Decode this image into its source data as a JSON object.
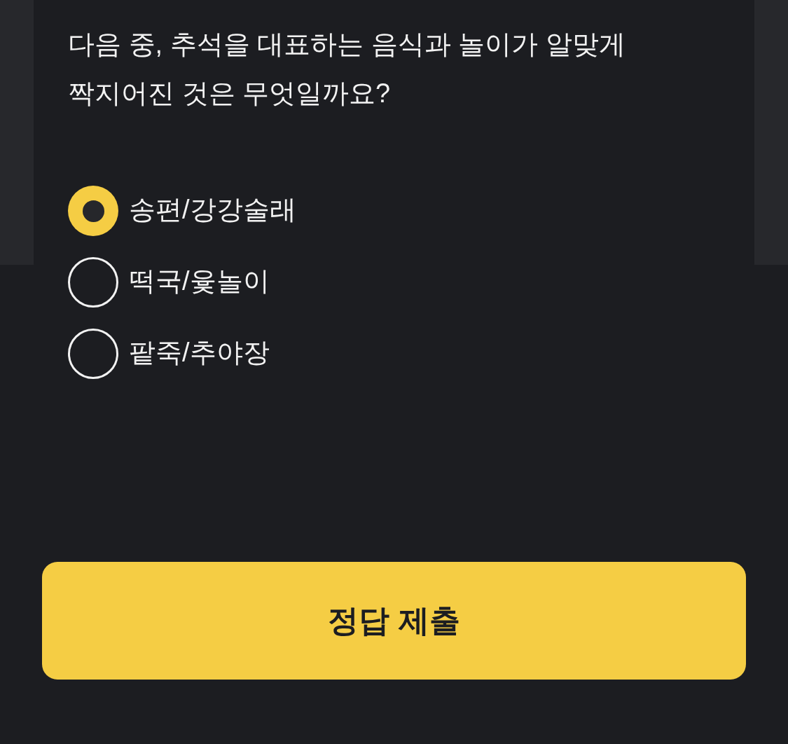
{
  "question": "다음 중, 추석을 대표하는 음식과 놀이가 알맞게 짝지어진 것은 무엇일까요?",
  "options": [
    {
      "label": "송편/강강술래",
      "selected": true
    },
    {
      "label": "떡국/윷놀이",
      "selected": false
    },
    {
      "label": "팥죽/추야장",
      "selected": false
    }
  ],
  "submit_button": {
    "label": "정답 제출"
  }
}
